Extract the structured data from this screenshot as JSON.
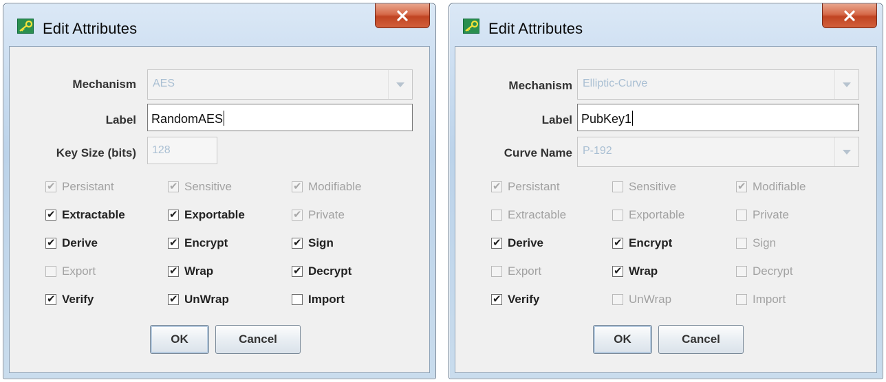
{
  "dialogs": [
    {
      "title": "Edit Attributes",
      "fields": {
        "mechanism": {
          "label": "Mechanism",
          "value": "AES"
        },
        "label": {
          "label": "Label",
          "value": "RandomAES"
        },
        "third": {
          "label": "Key Size (bits)",
          "value": "128"
        }
      },
      "checkboxes": [
        {
          "label": "Persistant",
          "checked": true,
          "enabled": false
        },
        {
          "label": "Sensitive",
          "checked": true,
          "enabled": false
        },
        {
          "label": "Modifiable",
          "checked": true,
          "enabled": false
        },
        {
          "label": "Extractable",
          "checked": true,
          "enabled": true
        },
        {
          "label": "Exportable",
          "checked": true,
          "enabled": true
        },
        {
          "label": "Private",
          "checked": true,
          "enabled": false
        },
        {
          "label": "Derive",
          "checked": true,
          "enabled": true
        },
        {
          "label": "Encrypt",
          "checked": true,
          "enabled": true
        },
        {
          "label": "Sign",
          "checked": true,
          "enabled": true
        },
        {
          "label": "Export",
          "checked": false,
          "enabled": false
        },
        {
          "label": "Wrap",
          "checked": true,
          "enabled": true
        },
        {
          "label": "Decrypt",
          "checked": true,
          "enabled": true
        },
        {
          "label": "Verify",
          "checked": true,
          "enabled": true
        },
        {
          "label": "UnWrap",
          "checked": true,
          "enabled": true
        },
        {
          "label": "Import",
          "checked": false,
          "enabled": true
        }
      ],
      "buttons": {
        "ok": "OK",
        "cancel": "Cancel"
      }
    },
    {
      "title": "Edit Attributes",
      "fields": {
        "mechanism": {
          "label": "Mechanism",
          "value": "Elliptic-Curve"
        },
        "label": {
          "label": "Label",
          "value": "PubKey1"
        },
        "third": {
          "label": "Curve Name",
          "value": "P-192"
        }
      },
      "checkboxes": [
        {
          "label": "Persistant",
          "checked": true,
          "enabled": false
        },
        {
          "label": "Sensitive",
          "checked": false,
          "enabled": false
        },
        {
          "label": "Modifiable",
          "checked": true,
          "enabled": false
        },
        {
          "label": "Extractable",
          "checked": false,
          "enabled": false
        },
        {
          "label": "Exportable",
          "checked": false,
          "enabled": false
        },
        {
          "label": "Private",
          "checked": false,
          "enabled": false
        },
        {
          "label": "Derive",
          "checked": true,
          "enabled": true
        },
        {
          "label": "Encrypt",
          "checked": true,
          "enabled": true
        },
        {
          "label": "Sign",
          "checked": false,
          "enabled": false
        },
        {
          "label": "Export",
          "checked": false,
          "enabled": false
        },
        {
          "label": "Wrap",
          "checked": true,
          "enabled": true
        },
        {
          "label": "Decrypt",
          "checked": false,
          "enabled": false
        },
        {
          "label": "Verify",
          "checked": true,
          "enabled": true
        },
        {
          "label": "UnWrap",
          "checked": false,
          "enabled": false
        },
        {
          "label": "Import",
          "checked": false,
          "enabled": false
        }
      ],
      "buttons": {
        "ok": "OK",
        "cancel": "Cancel"
      }
    }
  ],
  "icons": {
    "app": "key-icon",
    "close": "close-icon",
    "dropdown": "chevron-down-icon"
  },
  "colors": {
    "close_button": "#c9502e",
    "titlebar": "#cfe0f2",
    "disabled_text": "#a9bfd3"
  }
}
